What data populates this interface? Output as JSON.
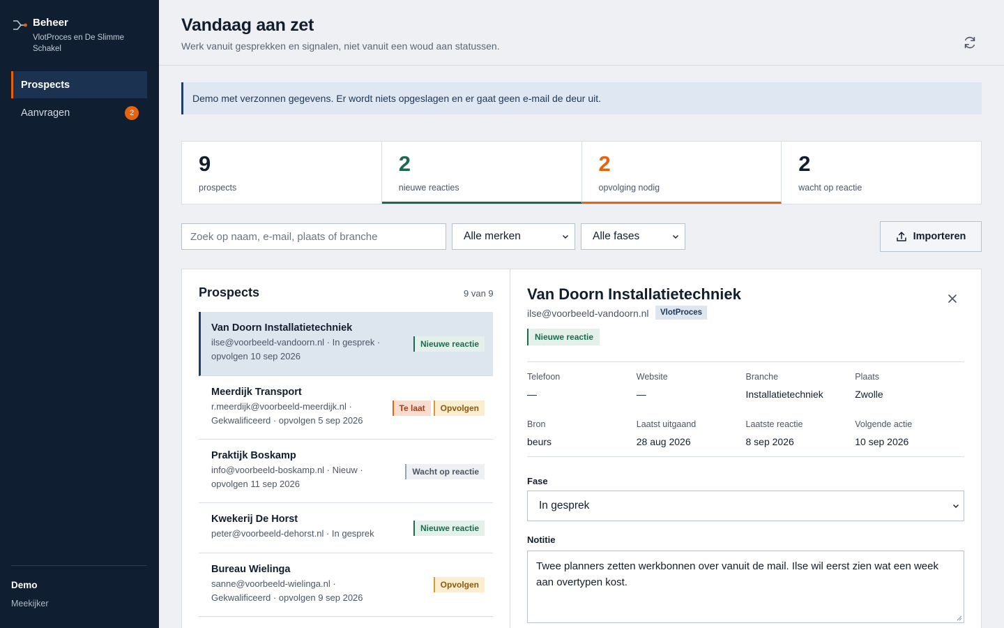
{
  "sidebar": {
    "brand_title": "Beheer",
    "brand_sub": "VlotProces en De Slimme Schakel",
    "nav": [
      {
        "label": "Prospects",
        "active": true
      },
      {
        "label": "Aanvragen",
        "badge": "2"
      }
    ],
    "footer_title": "Demo",
    "footer_sub": "Meekijker"
  },
  "header": {
    "title": "Vandaag aan zet",
    "subtitle": "Werk vanuit gesprekken en signalen, niet vanuit een woud aan statussen."
  },
  "notice": "Demo met verzonnen gegevens. Er wordt niets opgeslagen en er gaat geen e-mail de deur uit.",
  "stats": [
    {
      "value": "9",
      "label": "prospects"
    },
    {
      "value": "2",
      "label": "nieuwe reacties"
    },
    {
      "value": "2",
      "label": "opvolging nodig"
    },
    {
      "value": "2",
      "label": "wacht op reactie"
    }
  ],
  "filters": {
    "search_placeholder": "Zoek op naam, e-mail, plaats of branche",
    "brand": "Alle merken",
    "phase": "Alle fases",
    "import_label": "Importeren"
  },
  "list": {
    "title": "Prospects",
    "count": "9 van 9",
    "rows": [
      {
        "name": "Van Doorn Installatietechniek",
        "meta": "ilse@voorbeeld-vandoorn.nl · In gesprek · opvolgen 10 sep 2026",
        "tags": [
          "Nieuwe reactie"
        ]
      },
      {
        "name": "Meerdijk Transport",
        "meta": "r.meerdijk@voorbeeld-meerdijk.nl · Gekwalificeerd · opvolgen 5 sep 2026",
        "tags": [
          "Te laat",
          "Opvolgen"
        ]
      },
      {
        "name": "Praktijk Boskamp",
        "meta": "info@voorbeeld-boskamp.nl · Nieuw · opvolgen 11 sep 2026",
        "tags": [
          "Wacht op reactie"
        ]
      },
      {
        "name": "Kwekerij De Horst",
        "meta": "peter@voorbeeld-dehorst.nl · In gesprek",
        "tags": [
          "Nieuwe reactie"
        ]
      },
      {
        "name": "Bureau Wielinga",
        "meta": "sanne@voorbeeld-wielinga.nl · Gekwalificeerd · opvolgen 9 sep 2026",
        "tags": [
          "Opvolgen"
        ]
      }
    ]
  },
  "detail": {
    "title": "Van Doorn Installatietechniek",
    "email": "ilse@voorbeeld-vandoorn.nl",
    "brand": "VlotProces",
    "status": "Nieuwe reactie",
    "info_row1": [
      {
        "label": "Telefoon",
        "value": "—"
      },
      {
        "label": "Website",
        "value": "—"
      },
      {
        "label": "Branche",
        "value": "Installatietechniek"
      },
      {
        "label": "Plaats",
        "value": "Zwolle"
      }
    ],
    "info_row2": [
      {
        "label": "Bron",
        "value": "beurs"
      },
      {
        "label": "Laatst uitgaand",
        "value": "28 aug 2026"
      },
      {
        "label": "Laatste reactie",
        "value": "8 sep 2026"
      },
      {
        "label": "Volgende actie",
        "value": "10 sep 2026"
      }
    ],
    "phase_label": "Fase",
    "phase_value": "In gesprek",
    "note_label": "Notitie",
    "note_value": "Twee planners zetten werkbonnen over vanuit de mail. Ilse wil eerst zien wat een week aan overtypen kost."
  },
  "colors": {
    "sidebar_bg": "#0f1e31",
    "accent_orange": "#e8620c",
    "accent_green": "#1a6b4e",
    "navy": "#1d3f66"
  }
}
